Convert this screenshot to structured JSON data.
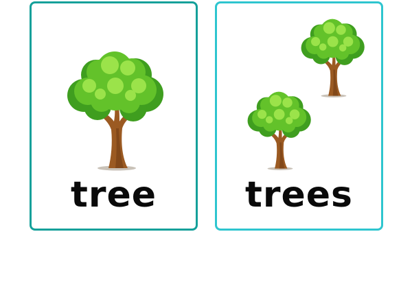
{
  "cards": [
    {
      "word": "tree",
      "image": "tree-icon",
      "tree_count": 1,
      "border_color": "#14a09a"
    },
    {
      "word": "trees",
      "image": "tree-icon",
      "tree_count": 2,
      "border_color": "#2ec5cf"
    }
  ],
  "colors": {
    "leaf_dark": "#3f9e1f",
    "leaf_mid": "#63c22a",
    "leaf_light": "#9be34a",
    "trunk": "#9b5a22",
    "trunk_dark": "#6d3b12"
  }
}
